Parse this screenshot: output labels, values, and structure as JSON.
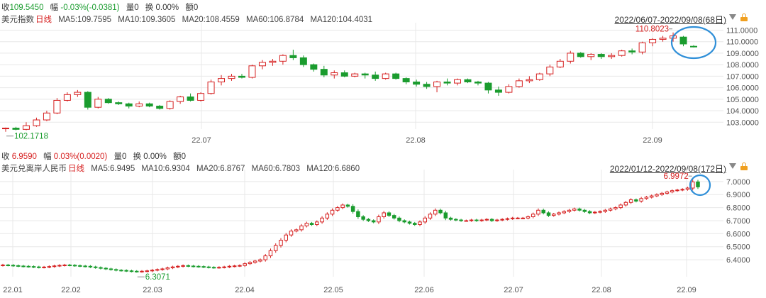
{
  "top": {
    "quote": {
      "close_label": "收",
      "close_value": "109.5450",
      "change_label": "幅",
      "change_value": "-0.03%(-0.0381)",
      "volume_label": "量",
      "volume_value": "0",
      "turnover_label": "换",
      "turnover_value": "0.00%",
      "amount_label": "额",
      "amount_value": "0"
    },
    "name": "美元指数",
    "period": "日线",
    "ma": [
      "MA5:109.7595",
      "MA10:109.3605",
      "MA20:108.4559",
      "MA60:106.8784",
      "MA120:104.4031"
    ],
    "date_range": "2022/06/07-2022/09/08(68日)"
  },
  "bottom": {
    "quote": {
      "close_label": "收",
      "close_value": "6.9590",
      "change_label": "幅",
      "change_value": "0.03%(0.0020)",
      "volume_label": "量",
      "volume_value": "0",
      "turnover_label": "换",
      "turnover_value": "0.00%",
      "amount_label": "额",
      "amount_value": "0"
    },
    "name": "美元兑离岸人民币",
    "period": "日线",
    "ma": [
      "MA5:6.9495",
      "MA10:6.9304",
      "MA20:6.8767",
      "MA60:6.7803",
      "MA120:6.6860"
    ],
    "date_range": "2022/01/12-2022/09/08(172日)"
  },
  "colors": {
    "up": "#d62020",
    "down": "#1a9c2e",
    "grid": "#e8e8e8",
    "circle": "#2f8fd8",
    "lock": "#f0a020"
  },
  "chart_data": [
    {
      "type": "candlestick",
      "title": "美元指数",
      "ylim": [
        102.4,
        111.4
      ],
      "y_ticks": [
        "111.0000",
        "110.0000",
        "109.0000",
        "108.0000",
        "107.0000",
        "106.0000",
        "105.0000",
        "104.0000",
        "103.0000"
      ],
      "x_ticks": [
        "22.07",
        "22.08",
        "22.09"
      ],
      "annotations": {
        "high": "110.8023",
        "low": "102.1718"
      },
      "highlight": "last candles circled in blue",
      "candles": [
        [
          102.44,
          102.54,
          102.17,
          102.49
        ],
        [
          102.49,
          102.6,
          102.3,
          102.38
        ],
        [
          102.38,
          103.0,
          102.3,
          102.7
        ],
        [
          102.7,
          103.4,
          102.6,
          103.2
        ],
        [
          103.2,
          104.0,
          103.1,
          103.8
        ],
        [
          103.8,
          105.1,
          103.7,
          104.9
        ],
        [
          104.9,
          105.6,
          104.8,
          105.4
        ],
        [
          105.4,
          105.8,
          105.2,
          105.6
        ],
        [
          105.6,
          105.7,
          104.1,
          104.3
        ],
        [
          104.3,
          105.2,
          104.2,
          105.0
        ],
        [
          105.0,
          105.1,
          104.6,
          104.7
        ],
        [
          104.7,
          104.8,
          104.5,
          104.6
        ],
        [
          104.6,
          104.7,
          104.2,
          104.4
        ],
        [
          104.4,
          104.8,
          104.3,
          104.6
        ],
        [
          104.6,
          104.7,
          104.3,
          104.4
        ],
        [
          104.4,
          104.5,
          104.1,
          104.2
        ],
        [
          104.2,
          104.9,
          104.1,
          104.8
        ],
        [
          104.8,
          105.3,
          104.6,
          105.2
        ],
        [
          105.2,
          105.5,
          104.8,
          104.9
        ],
        [
          104.9,
          105.6,
          104.8,
          105.5
        ],
        [
          105.5,
          106.7,
          105.4,
          106.5
        ],
        [
          106.5,
          107.1,
          106.2,
          106.8
        ],
        [
          106.8,
          107.2,
          106.6,
          107.0
        ],
        [
          107.0,
          107.2,
          106.8,
          106.9
        ],
        [
          106.9,
          108.0,
          106.8,
          107.9
        ],
        [
          107.9,
          108.4,
          107.6,
          108.2
        ],
        [
          108.2,
          108.5,
          107.9,
          108.3
        ],
        [
          108.3,
          108.9,
          108.0,
          108.8
        ],
        [
          108.8,
          109.3,
          108.4,
          108.6
        ],
        [
          108.6,
          108.8,
          107.8,
          108.0
        ],
        [
          108.0,
          108.1,
          107.4,
          107.6
        ],
        [
          107.6,
          107.9,
          106.9,
          107.1
        ],
        [
          107.1,
          107.5,
          106.8,
          107.3
        ],
        [
          107.3,
          107.5,
          106.9,
          107.0
        ],
        [
          107.0,
          107.3,
          106.9,
          107.2
        ],
        [
          107.2,
          107.3,
          106.8,
          107.1
        ],
        [
          107.1,
          107.4,
          106.6,
          106.8
        ],
        [
          106.8,
          107.3,
          106.7,
          107.2
        ],
        [
          107.2,
          107.3,
          106.7,
          106.8
        ],
        [
          106.8,
          106.9,
          106.3,
          106.5
        ],
        [
          106.5,
          106.7,
          106.1,
          106.3
        ],
        [
          106.3,
          106.5,
          105.9,
          106.1
        ],
        [
          106.1,
          106.6,
          105.6,
          106.5
        ],
        [
          106.5,
          106.8,
          106.2,
          106.4
        ],
        [
          106.4,
          106.8,
          106.2,
          106.7
        ],
        [
          106.7,
          106.8,
          106.4,
          106.5
        ],
        [
          106.5,
          106.6,
          106.2,
          106.4
        ],
        [
          106.4,
          106.5,
          105.5,
          105.8
        ],
        [
          105.8,
          106.1,
          105.3,
          105.6
        ],
        [
          105.6,
          106.3,
          105.5,
          106.1
        ],
        [
          106.1,
          106.8,
          106.0,
          106.6
        ],
        [
          106.6,
          107.0,
          106.4,
          106.7
        ],
        [
          106.7,
          107.3,
          106.6,
          107.2
        ],
        [
          107.2,
          108.0,
          107.0,
          107.8
        ],
        [
          107.8,
          108.5,
          107.7,
          108.3
        ],
        [
          108.3,
          109.2,
          108.1,
          109.0
        ],
        [
          109.0,
          109.1,
          108.6,
          108.7
        ],
        [
          108.7,
          109.0,
          108.4,
          108.9
        ],
        [
          108.9,
          109.0,
          108.5,
          108.7
        ],
        [
          108.7,
          109.0,
          108.5,
          108.8
        ],
        [
          108.8,
          109.3,
          108.7,
          109.2
        ],
        [
          109.2,
          109.4,
          108.9,
          109.1
        ],
        [
          109.1,
          110.0,
          108.9,
          109.9
        ],
        [
          109.9,
          110.3,
          109.6,
          110.2
        ],
        [
          110.2,
          110.5,
          110.0,
          110.3
        ],
        [
          110.3,
          110.8,
          110.0,
          110.5
        ],
        [
          110.4,
          110.5,
          109.6,
          109.8
        ],
        [
          109.6,
          109.7,
          109.5,
          109.55
        ]
      ]
    },
    {
      "type": "candlestick",
      "title": "美元兑离岸人民币",
      "ylim": [
        6.27,
        7.07
      ],
      "y_ticks": [
        "7.0000",
        "6.9000",
        "6.8000",
        "6.7000",
        "6.6000",
        "6.5000",
        "6.4000"
      ],
      "x_ticks": [
        "22.01",
        "22.02",
        "22.03",
        "22.04",
        "22.05",
        "22.06",
        "22.07",
        "22.08",
        "22.09"
      ],
      "annotations": {
        "high": "6.9972",
        "low": "6.3071"
      },
      "highlight": "last candles circled in blue",
      "closes": [
        6.36,
        6.358,
        6.355,
        6.352,
        6.35,
        6.348,
        6.345,
        6.342,
        6.344,
        6.348,
        6.353,
        6.357,
        6.36,
        6.358,
        6.355,
        6.352,
        6.35,
        6.345,
        6.34,
        6.335,
        6.33,
        6.325,
        6.32,
        6.318,
        6.315,
        6.312,
        6.31,
        6.312,
        6.315,
        6.32,
        6.325,
        6.33,
        6.338,
        6.345,
        6.35,
        6.355,
        6.352,
        6.35,
        6.348,
        6.345,
        6.342,
        6.34,
        6.342,
        6.345,
        6.35,
        6.353,
        6.356,
        6.37,
        6.38,
        6.39,
        6.4,
        6.43,
        6.47,
        6.51,
        6.55,
        6.59,
        6.62,
        6.63,
        6.66,
        6.68,
        6.67,
        6.69,
        6.72,
        6.75,
        6.78,
        6.8,
        6.82,
        6.81,
        6.77,
        6.73,
        6.71,
        6.7,
        6.69,
        6.73,
        6.76,
        6.74,
        6.72,
        6.7,
        6.69,
        6.68,
        6.67,
        6.69,
        6.72,
        6.75,
        6.78,
        6.76,
        6.72,
        6.71,
        6.705,
        6.7,
        6.7,
        6.705,
        6.7,
        6.705,
        6.71,
        6.7,
        6.705,
        6.71,
        6.715,
        6.72,
        6.72,
        6.72,
        6.73,
        6.75,
        6.78,
        6.76,
        6.74,
        6.75,
        6.76,
        6.77,
        6.78,
        6.79,
        6.78,
        6.77,
        6.76,
        6.765,
        6.77,
        6.78,
        6.79,
        6.8,
        6.82,
        6.84,
        6.86,
        6.85,
        6.87,
        6.88,
        6.89,
        6.9,
        6.91,
        6.92,
        6.93,
        6.935,
        6.94,
        6.95,
        6.9972,
        6.959
      ]
    }
  ]
}
